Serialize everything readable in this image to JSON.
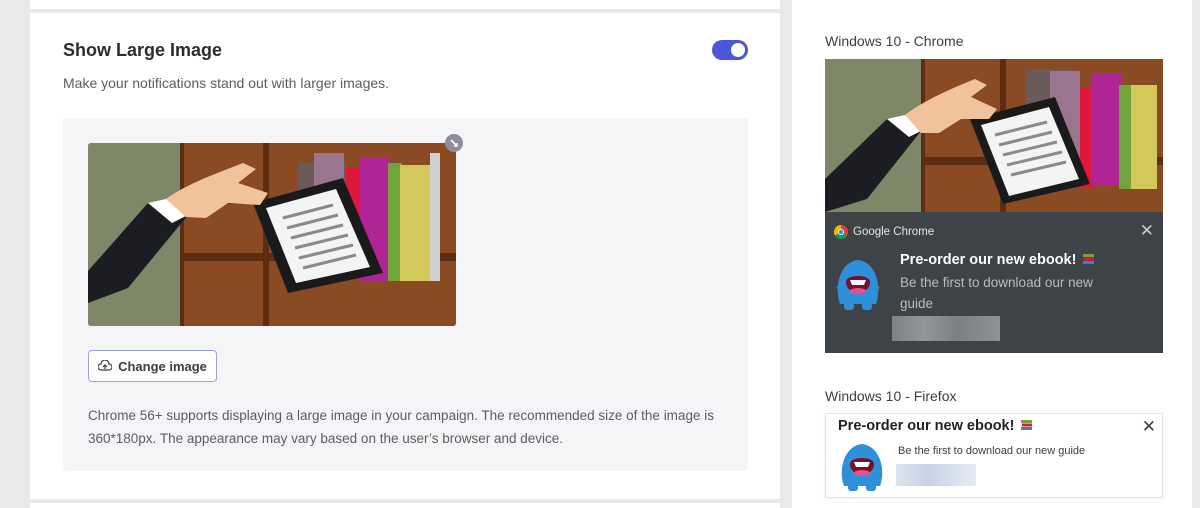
{
  "settings": {
    "title": "Show Large Image",
    "description": "Make your notifications stand out with larger images.",
    "toggle_on": true,
    "change_image_label": "Change image",
    "help_text": "Chrome 56+ supports displaying a large image in your campaign. The recommended size of the image is 360*180px. The appearance may vary based on the user’s browser and device."
  },
  "previews": {
    "chrome": {
      "label": "Windows 10 - Chrome",
      "app_name": "Google Chrome",
      "title": "Pre-order our new ebook!",
      "body": "Be the first to download our new guide"
    },
    "firefox": {
      "label": "Windows 10 - Firefox",
      "title": "Pre-order our new ebook!",
      "body": "Be the first to download our new guide"
    }
  },
  "colors": {
    "accent": "#4a57d6",
    "chrome_dark": "#3e4347"
  }
}
